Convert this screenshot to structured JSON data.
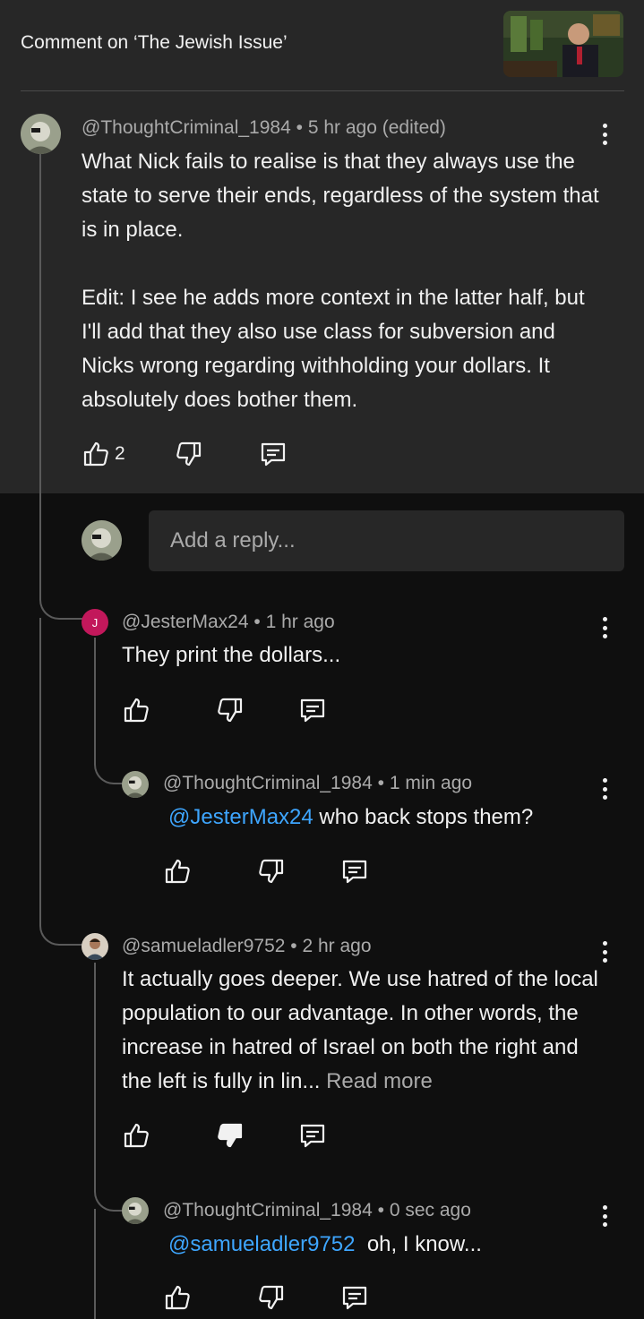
{
  "header": {
    "title": "Comment on ‘The Jewish Issue’",
    "thumbnail_icon": "video-thumbnail"
  },
  "main_comment": {
    "author": "@ThoughtCriminal_1984",
    "sep": "•",
    "time": "5 hr ago (edited)",
    "paragraph1": "What Nick fails to realise is that they always use the state to serve their ends, regardless of the system that is in place.",
    "paragraph2": "Edit: I see he adds more context in the latter half, but I'll add that they also use class for subversion and Nicks wrong regarding withholding your dollars. It absolutely does bother them.",
    "likes": "2"
  },
  "reply_input": {
    "placeholder": "Add a reply..."
  },
  "replies": [
    {
      "avatar_letter": "J",
      "author": "@JesterMax24",
      "sep": "•",
      "time": "1 hr ago",
      "text": "They print the dollars..."
    },
    {
      "author": "@ThoughtCriminal_1984",
      "sep": "•",
      "time": "1 min ago",
      "mention": "@JesterMax24",
      "text": " who back stops them?"
    },
    {
      "author": "@samueladler9752",
      "sep": "•",
      "time": "2 hr ago",
      "text": "It actually goes deeper. We use hatred of the local population to our advantage. In other words, the increase in hatred of Israel on both the right and the left is fully in lin... ",
      "read_more": "Read more",
      "disliked": true
    },
    {
      "author": "@ThoughtCriminal_1984",
      "sep": "•",
      "time": "0 sec ago",
      "mention": "@samueladler9752",
      "text": "  oh, I know..."
    }
  ],
  "colors": {
    "panel": "#272727",
    "background": "#0f0f0f",
    "mention": "#3ea6ff",
    "avatar_j": "#c2185b"
  }
}
